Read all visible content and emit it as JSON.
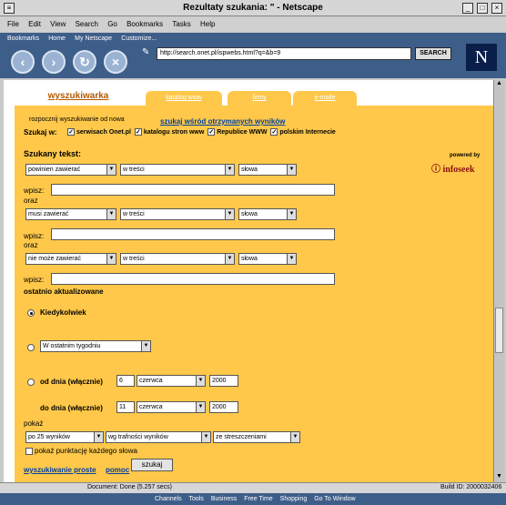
{
  "window": {
    "title": "Rezultaty szukania: \" - Netscape"
  },
  "menu": [
    "File",
    "Edit",
    "View",
    "Search",
    "Go",
    "Bookmarks",
    "Tasks",
    "Help"
  ],
  "personal_toolbar": [
    "Bookmarks",
    "Home",
    "My Netscape",
    "Customize..."
  ],
  "nav": {
    "url": "http://search.onet.pl/ispwebs.html?q=&b=9",
    "search_label": "SEARCH",
    "logo": "N"
  },
  "tabs": {
    "active": "wyszukiwarka",
    "others": [
      "katalog www",
      "firmy",
      "e-maile"
    ]
  },
  "links": {
    "restart": "rozpocznij wyszukiwanie od nowa",
    "within": "szukaj wśród otrzymanych wyników"
  },
  "search_in": {
    "label": "Szukaj w:",
    "options": [
      "serwisach Onet.pl",
      "katalogu stron www",
      "Republice WWW",
      "polskim Internecie"
    ]
  },
  "powered": {
    "line1": "powered by",
    "line2": "infoseek"
  },
  "query": {
    "title": "Szukany tekst:",
    "rows": [
      {
        "mode": "powinien zawierać",
        "where": "w treści",
        "type": "słowa"
      },
      {
        "mode": "musi zawierać",
        "where": "w treści",
        "type": "słowa"
      },
      {
        "mode": "nie może zawierać",
        "where": "w treści",
        "type": "słowa"
      }
    ],
    "wpisz": "wpisz:",
    "oraz": "oraz"
  },
  "updated": {
    "title": "ostatnio aktualizowane",
    "any": "Kiedykolwiek",
    "period": "W ostatnim tygodniu",
    "from_label": "od dnia (włącznie)",
    "from_day": "6",
    "from_month": "czerwca",
    "from_year": "2000",
    "to_label": "do dnia (włącznie)",
    "to_day": "11",
    "to_month": "czerwca",
    "to_year": "2000"
  },
  "show": {
    "title": "pokaż",
    "count": "po 25 wyników",
    "order": "wg trafności wyników",
    "summary": "ze streszczeniami",
    "score_label": "pokaż punktację każdego słowa"
  },
  "footer": {
    "simple": "wyszukiwanie proste",
    "help": "pomoc",
    "submit": "szukaj"
  },
  "status": {
    "text": "Document: Done (5.257 secs)",
    "build": "Build ID: 2000032406"
  },
  "taskbar": [
    "Channels",
    "Tools",
    "Business",
    "Free Time",
    "Shopping",
    "Go To Window"
  ]
}
